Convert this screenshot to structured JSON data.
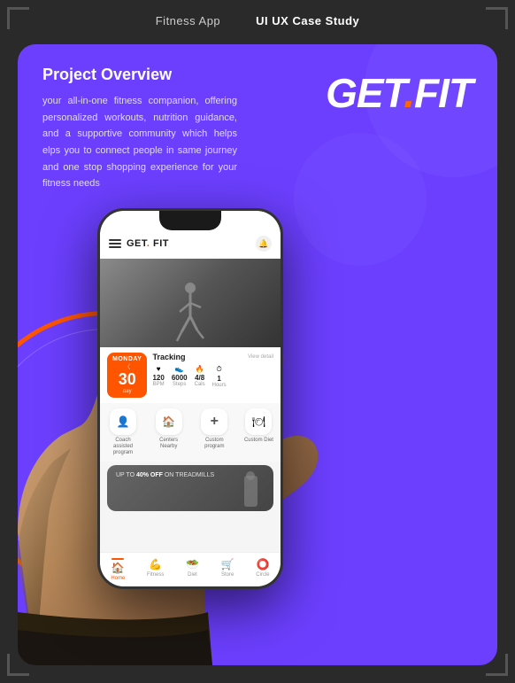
{
  "header": {
    "items": [
      {
        "label": "Fitness App",
        "active": false
      },
      {
        "label": "UI UX Case Study",
        "active": true
      }
    ]
  },
  "card": {
    "project_overview": {
      "title": "Project Overview",
      "description": "your all-in-one fitness companion, offering personalized workouts, nutrition guidance, and a supportive community which helps elps you to connect people in same journey and one stop shopping experience for your fitness needs"
    },
    "logo": {
      "text_before_dot": "GET",
      "dot": ".",
      "text_after_dot": "FIT"
    }
  },
  "phone": {
    "app_name_before_dot": "GET",
    "app_name_dot": ".",
    "app_name_after_dot": " FIT",
    "tracking": {
      "day": "Monday",
      "number": "30",
      "sub": "day",
      "label": "Tracking",
      "view_detail": "View detail",
      "stats": [
        {
          "icon": "♥",
          "value": "120",
          "label": "BPM"
        },
        {
          "icon": "👟",
          "value": "6000",
          "label": "Steps"
        },
        {
          "icon": "🔥",
          "value": "4/8",
          "label": "Cals"
        },
        {
          "icon": "⏱",
          "value": "1",
          "label": "Hours"
        }
      ]
    },
    "quick_actions": [
      {
        "icon": "👤",
        "label": "Coach assisted program"
      },
      {
        "icon": "🏠",
        "label": "Centers Nearby"
      },
      {
        "icon": "➕",
        "label": "Custom program"
      },
      {
        "icon": "🍽",
        "label": "Custom Diet"
      }
    ],
    "promo": {
      "text_before": "UP TO ",
      "highlight": "40% OFF",
      "text_after": " ON TREADMILLS"
    },
    "nav": [
      {
        "icon": "🏠",
        "label": "Home",
        "active": true
      },
      {
        "icon": "💪",
        "label": "Fitness",
        "active": false
      },
      {
        "icon": "🥗",
        "label": "Diet",
        "active": false
      },
      {
        "icon": "🛒",
        "label": "Store",
        "active": false
      },
      {
        "icon": "⭕",
        "label": "Circle",
        "active": false
      }
    ]
  },
  "colors": {
    "bg": "#2a2a2a",
    "card_bg": "#6c3fff",
    "orange": "#ff5500",
    "white": "#ffffff"
  }
}
